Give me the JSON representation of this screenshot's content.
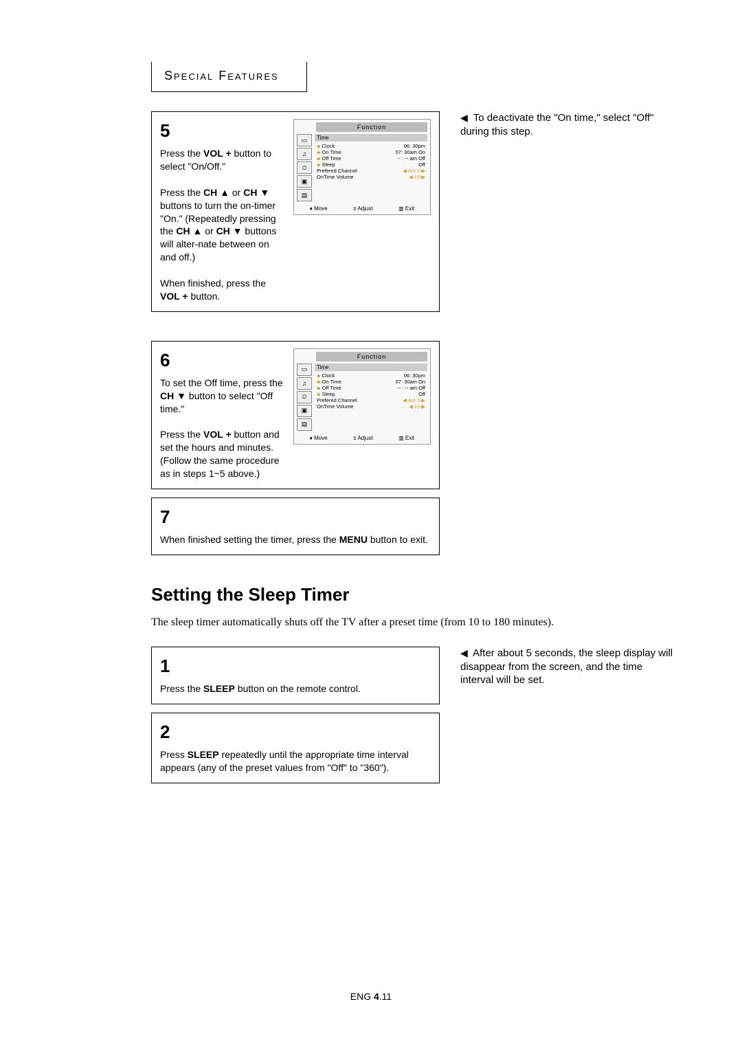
{
  "section_header": "Special Features",
  "note1_arrow": "▶",
  "note1": "To deactivate the \"On time,\" select \"Off\" during this step.",
  "step5": {
    "num": "5",
    "p1a": "Press the ",
    "p1b": "VOL +",
    "p1c": " button to select \"On/Off.\"",
    "p2a": "Press the ",
    "p2b": "CH ▲",
    "p2c": " or ",
    "p2d": "CH ▼",
    "p2e": " buttons to turn the on-timer \"On.\" (Repeatedly pressing the ",
    "p2f": "CH ▲",
    "p2g": " or ",
    "p2h": "CH ▼",
    "p2i": " buttons will alter-nate between on and off.)",
    "p3a": "When finished, press the ",
    "p3b": "VOL +",
    "p3c": " button."
  },
  "step6": {
    "num": "6",
    "p1a": "To set the Off time, press the ",
    "p1b": "CH ▼",
    "p1c": " button to select \"Off time.\"",
    "p2a": "Press the ",
    "p2b": "VOL +",
    "p2c": " button and set the hours and minutes. (Follow the same procedure as in steps 1~5 above.)"
  },
  "step7": {
    "num": "7",
    "p1a": "When finished setting the timer, press the ",
    "p1b": "MENU",
    "p1c": " button to exit."
  },
  "osd": {
    "function": "Function",
    "time_hdr": "Time",
    "rows": [
      {
        "label": "Clock",
        "val": "06: 30pm"
      },
      {
        "label": "On Time",
        "val": "07: 30am On"
      },
      {
        "label": "Off Time",
        "val": "-- : -- am  Off"
      },
      {
        "label": "Sleep",
        "val": "Off"
      },
      {
        "label": "Prefered Channel",
        "val": "◀ Ant 3 ▶"
      },
      {
        "label": "OnTime Volume",
        "val": "◀  10  ▶"
      }
    ],
    "foot_move": "♦ Move",
    "foot_adjust": "± Adjust",
    "foot_exit": "▥ Exit"
  },
  "heading2": "Setting the Sleep Timer",
  "intro": "The sleep timer automatically shuts off the TV after a preset time (from 10 to 180 minutes).",
  "step_s1": {
    "num": "1",
    "p1a": "Press the ",
    "p1b": "SLEEP",
    "p1c": " button on the remote control."
  },
  "step_s2": {
    "num": "2",
    "p1a": "Press ",
    "p1b": "SLEEP",
    "p1c": " repeatedly until the appropriate time interval appears (any of the preset values from \"Off\" to \"360\")."
  },
  "note2": "After about 5 seconds, the sleep display will disappear from the screen, and the time interval will be set.",
  "footer_pre": "ENG ",
  "footer_num": "4",
  "footer_post": ".11"
}
